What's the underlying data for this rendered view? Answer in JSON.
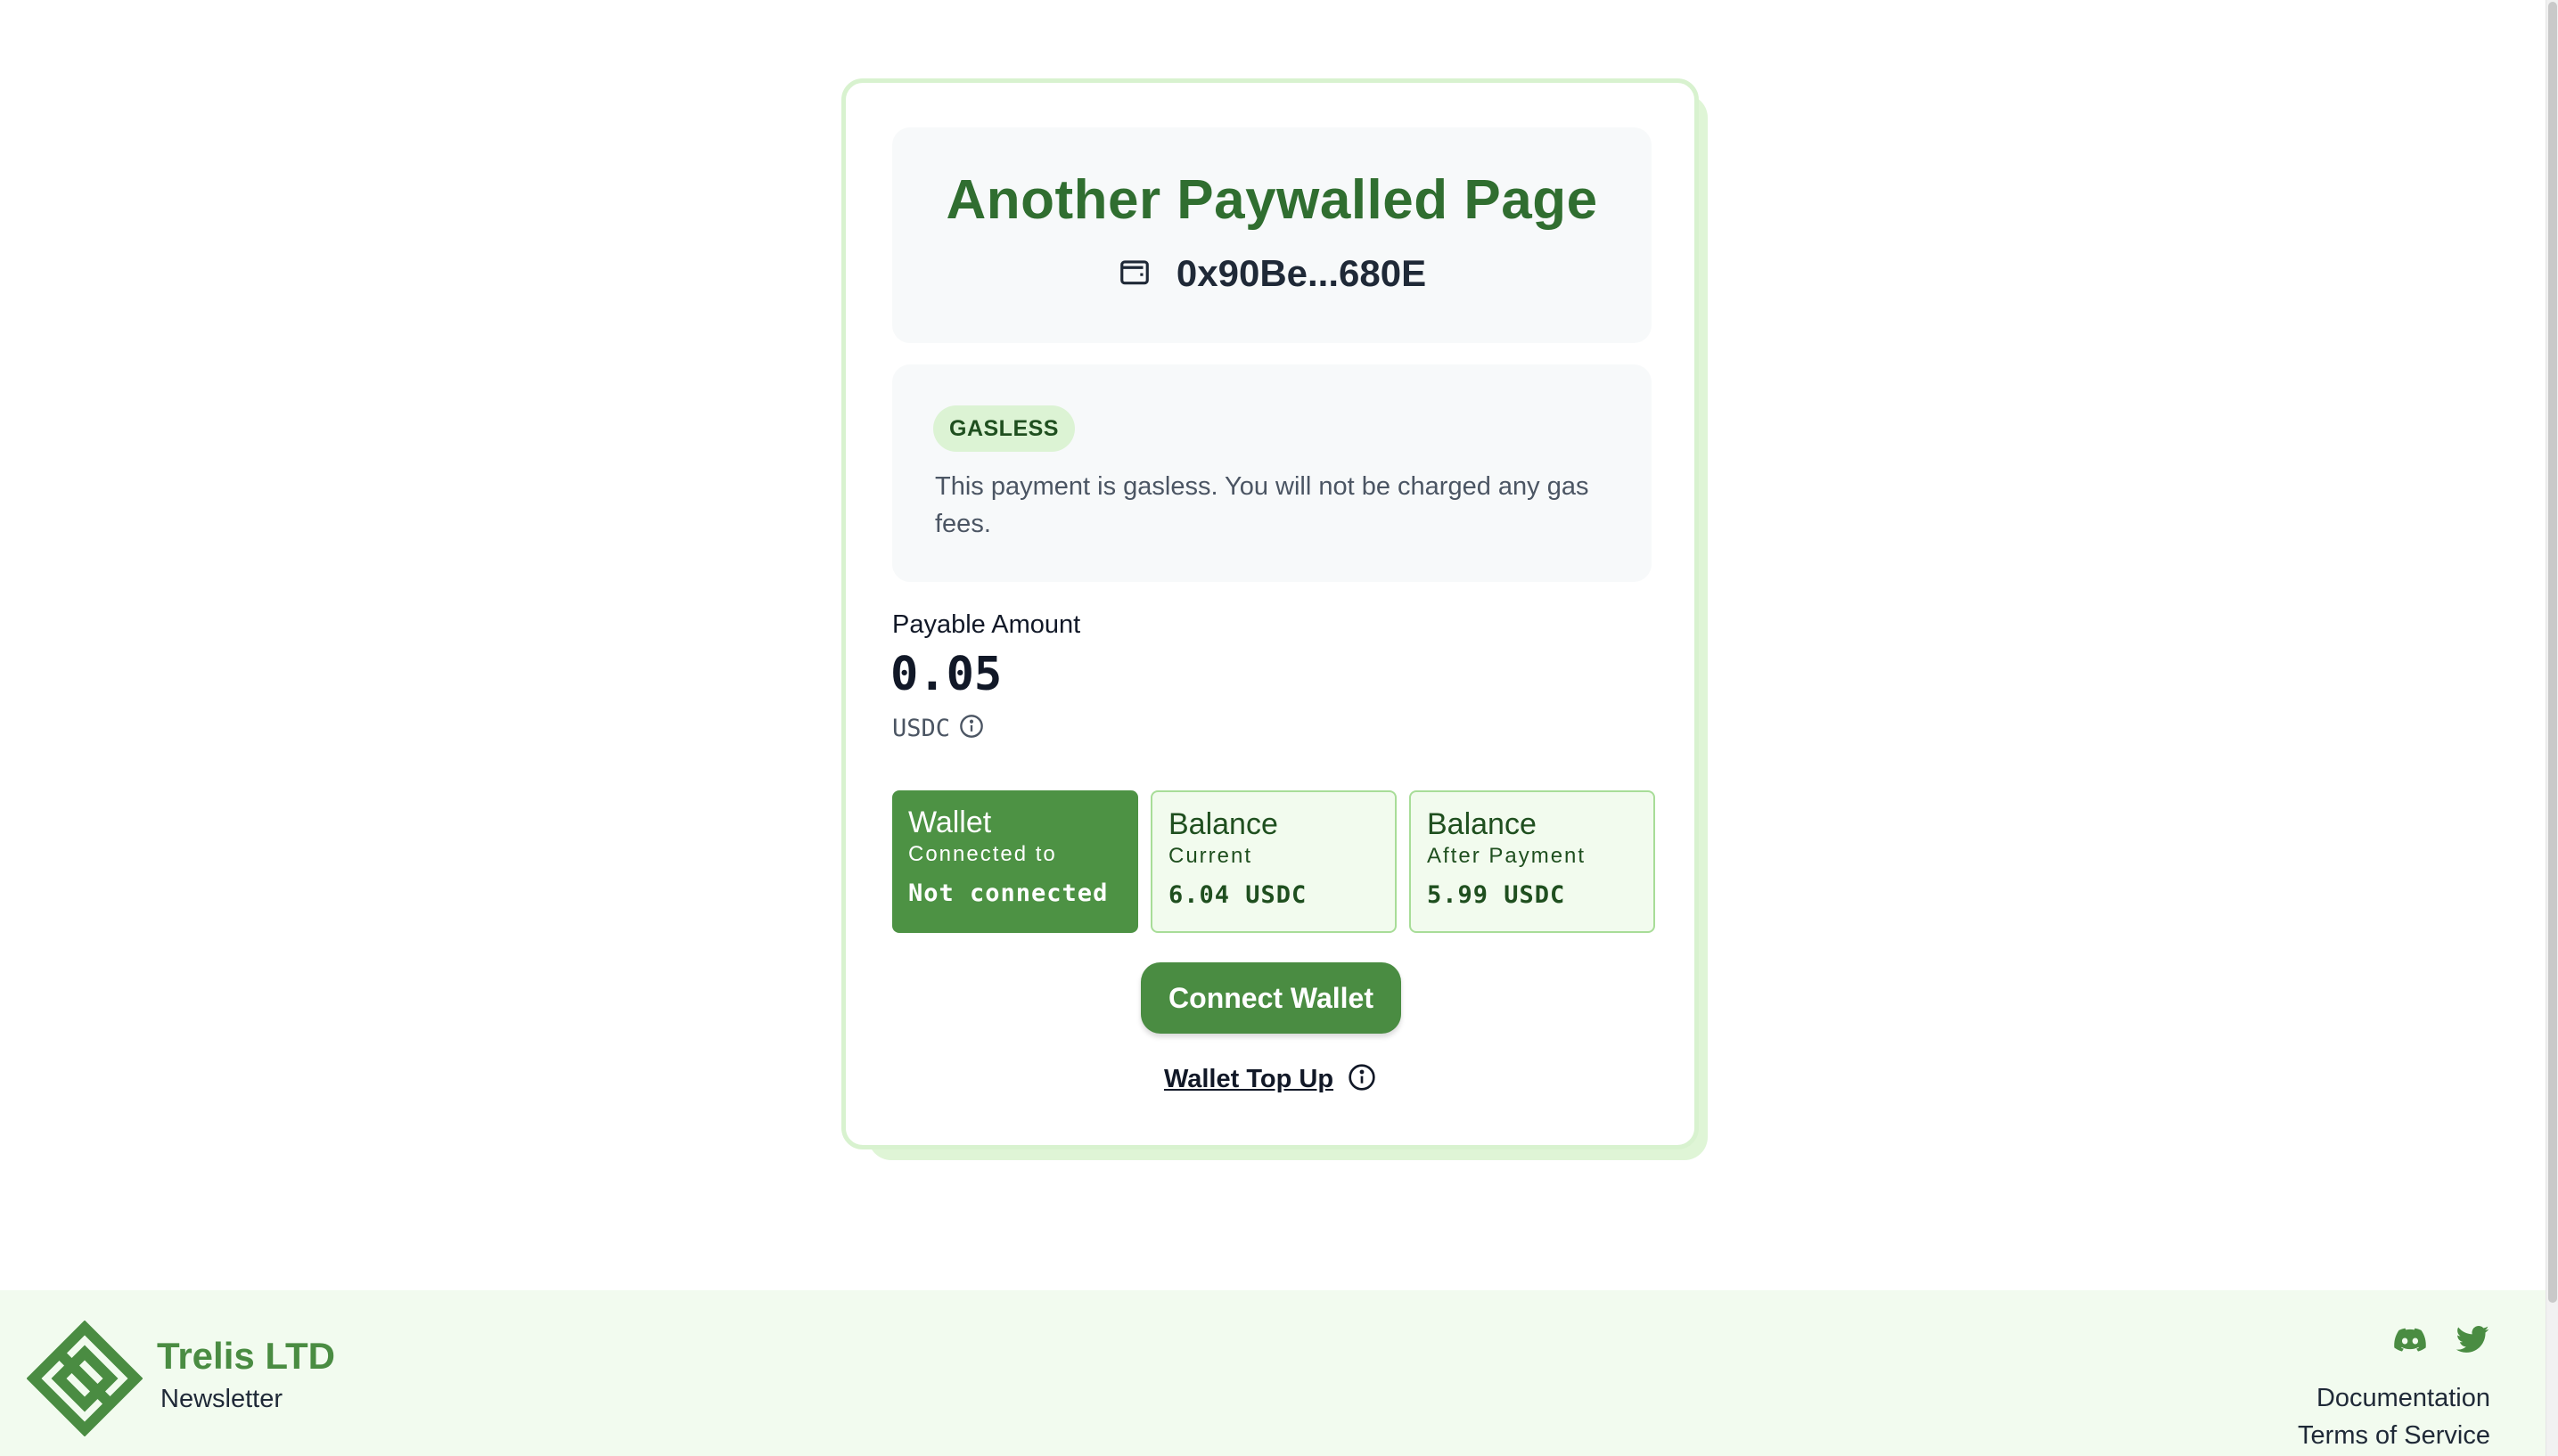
{
  "card": {
    "title": "Another Paywalled Page",
    "address": "0x90Be...680E",
    "gas_badge": "GASLESS",
    "gas_text": "This payment is gasless. You will not be charged any gas fees.",
    "payable_label": "Payable Amount",
    "payable_value": "0.05",
    "currency": "USDC",
    "tiles": [
      {
        "title": "Wallet",
        "sub": "Connected to",
        "value": "Not connected"
      },
      {
        "title": "Balance",
        "sub": "Current",
        "value": "6.04 USDC"
      },
      {
        "title": "Balance",
        "sub": "After Payment",
        "value": "5.99 USDC"
      }
    ],
    "connect_label": "Connect Wallet",
    "topup_label": "Wallet Top Up"
  },
  "footer": {
    "brand": "Trelis LTD",
    "newsletter": "Newsletter",
    "links": [
      "Documentation",
      "Terms of Service"
    ]
  },
  "colors": {
    "brand_green": "#4a8c42",
    "title_green": "#306e30",
    "badge_bg": "#dcf3d4",
    "footer_bg": "#f2fbef"
  }
}
